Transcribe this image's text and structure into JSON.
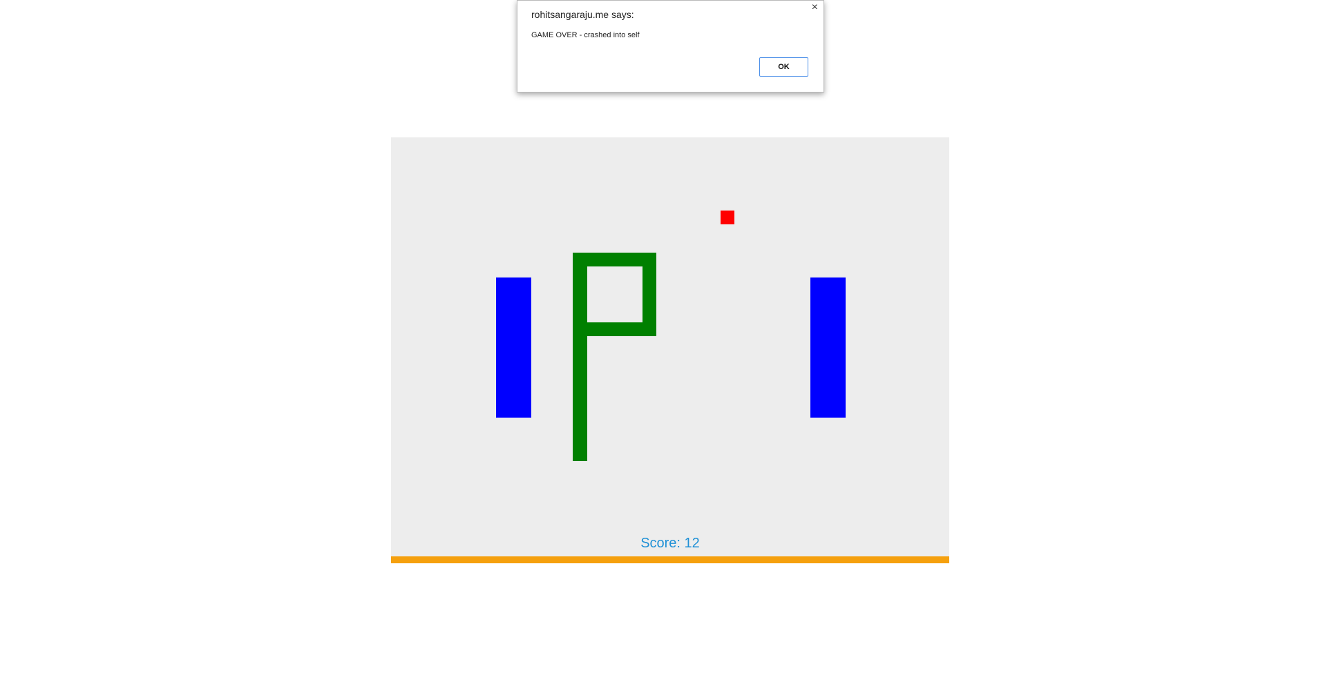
{
  "dialog": {
    "title": "rohitsangaraju.me says:",
    "message": "GAME OVER - crashed into self",
    "close_glyph": "×",
    "ok_label": "OK"
  },
  "game": {
    "score_text": "Score: 12",
    "colors": {
      "board": "#ededed",
      "bottom_bar": "#f5a00e",
      "walls": "#0000ff",
      "snake": "#008000",
      "food": "#ff0000",
      "score": "#1e90d6"
    }
  }
}
